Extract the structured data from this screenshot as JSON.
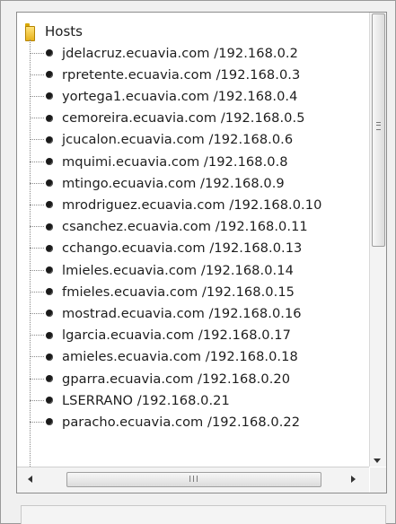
{
  "tree": {
    "root_label": "Hosts",
    "root_icon": "folder-icon",
    "node_icon": "host-node-icon",
    "hosts": [
      "jdelacruz.ecuavia.com /192.168.0.2",
      "rpretente.ecuavia.com /192.168.0.3",
      "yortega1.ecuavia.com /192.168.0.4",
      "cemoreira.ecuavia.com /192.168.0.5",
      "jcucalon.ecuavia.com /192.168.0.6",
      "mquimi.ecuavia.com /192.168.0.8",
      "mtingo.ecuavia.com /192.168.0.9",
      "mrodriguez.ecuavia.com /192.168.0.10",
      "csanchez.ecuavia.com /192.168.0.11",
      "cchango.ecuavia.com /192.168.0.13",
      "lmieles.ecuavia.com /192.168.0.14",
      "fmieles.ecuavia.com /192.168.0.15",
      "mostrad.ecuavia.com /192.168.0.16",
      "lgarcia.ecuavia.com /192.168.0.17",
      "amieles.ecuavia.com /192.168.0.18",
      "gparra.ecuavia.com /192.168.0.20",
      "LSERRANO /192.168.0.21",
      "paracho.ecuavia.com /192.168.0.22"
    ]
  },
  "scrollbars": {
    "horizontal_grip": "III",
    "vertical_position": 0.0,
    "horizontal_position": 0.0
  }
}
